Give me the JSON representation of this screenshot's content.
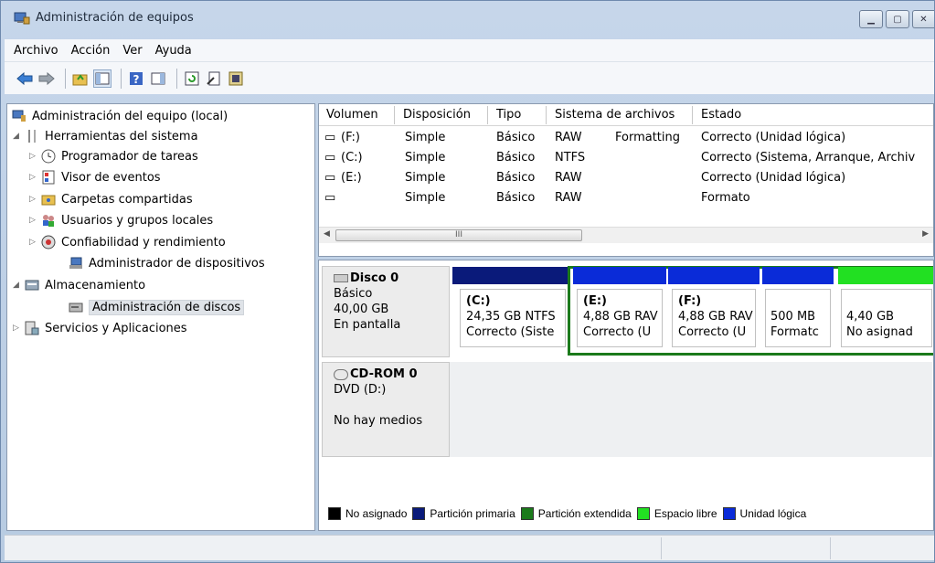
{
  "window": {
    "title": "Administración de equipos"
  },
  "menu": [
    "Archivo",
    "Acción",
    "Ver",
    "Ayuda"
  ],
  "tree": {
    "root": "Administración del equipo (local)",
    "system_tools": "Herramientas del sistema",
    "task_scheduler": "Programador de tareas",
    "event_viewer": "Visor de eventos",
    "shared_folders": "Carpetas compartidas",
    "local_users": "Usuarios y grupos locales",
    "reliability": "Confiabilidad y rendimiento",
    "device_manager": "Administrador de dispositivos",
    "storage": "Almacenamiento",
    "disk_management": "Administración de discos",
    "services": "Servicios y Aplicaciones"
  },
  "volumes": {
    "columns": [
      "Volumen",
      "Disposición",
      "Tipo",
      "Sistema de archivos",
      "Estado"
    ],
    "rows": [
      {
        "volume": "(F:)",
        "layout": "Simple",
        "type": "Básico",
        "fs": "RAW",
        "extra": "Formatting",
        "status": "Correcto (Unidad lógica)"
      },
      {
        "volume": "(C:)",
        "layout": "Simple",
        "type": "Básico",
        "fs": "NTFS",
        "extra": "",
        "status": "Correcto (Sistema, Arranque, Archiv"
      },
      {
        "volume": "(E:)",
        "layout": "Simple",
        "type": "Básico",
        "fs": "RAW",
        "extra": "",
        "status": "Correcto (Unidad lógica)"
      },
      {
        "volume": "",
        "layout": "Simple",
        "type": "Básico",
        "fs": "RAW",
        "extra": "",
        "status": "Formato"
      }
    ],
    "scroll_thumb": "III"
  },
  "disk0": {
    "name": "Disco 0",
    "kind": "Básico",
    "size": "40,00 GB",
    "state": "En pantalla",
    "partitions": [
      {
        "label": "(C:)",
        "line1": "24,35 GB NTFS",
        "line2": "Correcto (Siste",
        "color": "#0a1a7a"
      },
      {
        "label": "(E:)",
        "line1": "4,88 GB RAV",
        "line2": "Correcto (U",
        "color": "#0a2bd8"
      },
      {
        "label": "(F:)",
        "line1": "4,88 GB RAV",
        "line2": "Correcto (U",
        "color": "#0a2bd8"
      },
      {
        "label": "",
        "line1": "500 MB",
        "line2": "Formatc",
        "color": "#0a2bd8"
      },
      {
        "label": "",
        "line1": "4,40 GB",
        "line2": "No asignad",
        "color": "#22e022"
      }
    ]
  },
  "cdrom": {
    "name": "CD-ROM 0",
    "kind": "DVD (D:)",
    "state": "No hay medios"
  },
  "legend": [
    {
      "label": "No asignado",
      "color": "#000000"
    },
    {
      "label": "Partición primaria",
      "color": "#0a1a7a"
    },
    {
      "label": "Partición extendida",
      "color": "#1b7a1b"
    },
    {
      "label": "Espacio libre",
      "color": "#22e022"
    },
    {
      "label": "Unidad lógica",
      "color": "#0a2bd8"
    }
  ]
}
